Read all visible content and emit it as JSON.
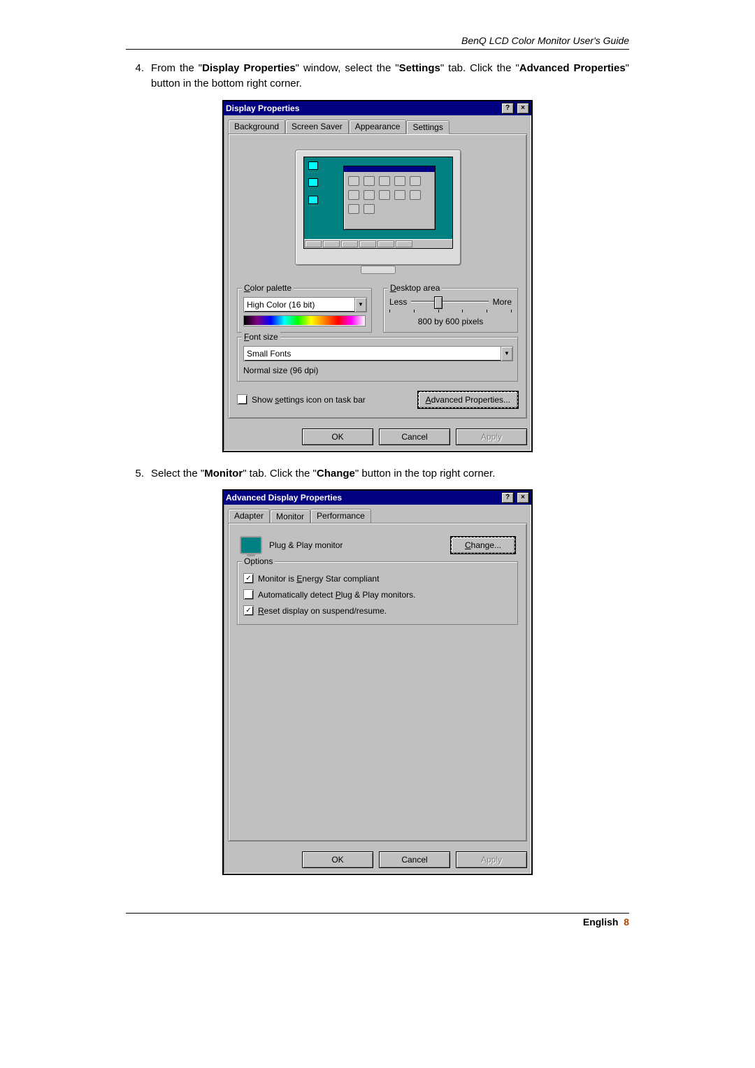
{
  "page_header": "BenQ LCD Color Monitor User's Guide",
  "steps": {
    "s4_num": "4.",
    "s4_pre": "From the \"",
    "s4_b1": "Display Properties",
    "s4_mid1": "\" window, select the \"",
    "s4_b2": "Settings",
    "s4_mid2": "\" tab. Click the \"",
    "s4_b3": "Advanced Properties",
    "s4_post": "\" button in the bottom right corner.",
    "s5_num": "5.",
    "s5_pre": "Select the \"",
    "s5_b1": "Monitor",
    "s5_mid1": "\" tab. Click the \"",
    "s5_b2": "Change",
    "s5_post": "\" button in the top right corner."
  },
  "dlg1": {
    "title": "Display Properties",
    "help_btn": "?",
    "close_btn": "×",
    "tabs": {
      "bg": "Background",
      "ss": "Screen Saver",
      "ap": "Appearance",
      "settings": "Settings"
    },
    "color_palette_legend": "Color palette",
    "color_palette_value": "High Color (16 bit)",
    "desktop_area_legend": "Desktop area",
    "less": "Less",
    "more": "More",
    "resolution": "800 by 600 pixels",
    "font_size_legend": "Font size",
    "font_size_value": "Small Fonts",
    "dpi_note": "Normal size (96 dpi)",
    "show_settings_chk": "Show settings icon on task bar",
    "advanced_btn": "Advanced Properties...",
    "ok": "OK",
    "cancel": "Cancel",
    "apply": "Apply"
  },
  "dlg2": {
    "title": "Advanced Display Properties",
    "help_btn": "?",
    "close_btn": "×",
    "tabs": {
      "adapter": "Adapter",
      "monitor": "Monitor",
      "performance": "Performance"
    },
    "monitor_label": "Plug & Play monitor",
    "change_btn": "Change...",
    "options_legend": "Options",
    "opt_energy": "Monitor is Energy Star compliant",
    "opt_autodetect": "Automatically detect Plug & Play monitors.",
    "opt_reset": "Reset display on suspend/resume.",
    "ok": "OK",
    "cancel": "Cancel",
    "apply": "Apply"
  },
  "footer": {
    "lang": "English",
    "page": "8"
  }
}
